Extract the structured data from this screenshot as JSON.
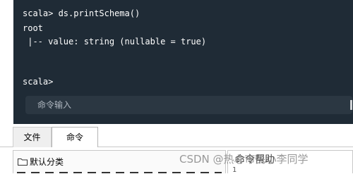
{
  "terminal": {
    "lines": [
      "scala> ds.printSchema()",
      "root",
      " |-- value: string (nullable = true)",
      "scala>"
    ],
    "input_placeholder": "命令输入"
  },
  "tabs": [
    {
      "label": "文件",
      "active": false
    },
    {
      "label": "命令",
      "active": true
    }
  ],
  "tree": {
    "folder_label": "默认分类",
    "icon": "folder-icon"
  },
  "help": {
    "title": "命令帮助",
    "line_number": "1"
  },
  "watermark": "CSDN @热心市民小李同学"
}
